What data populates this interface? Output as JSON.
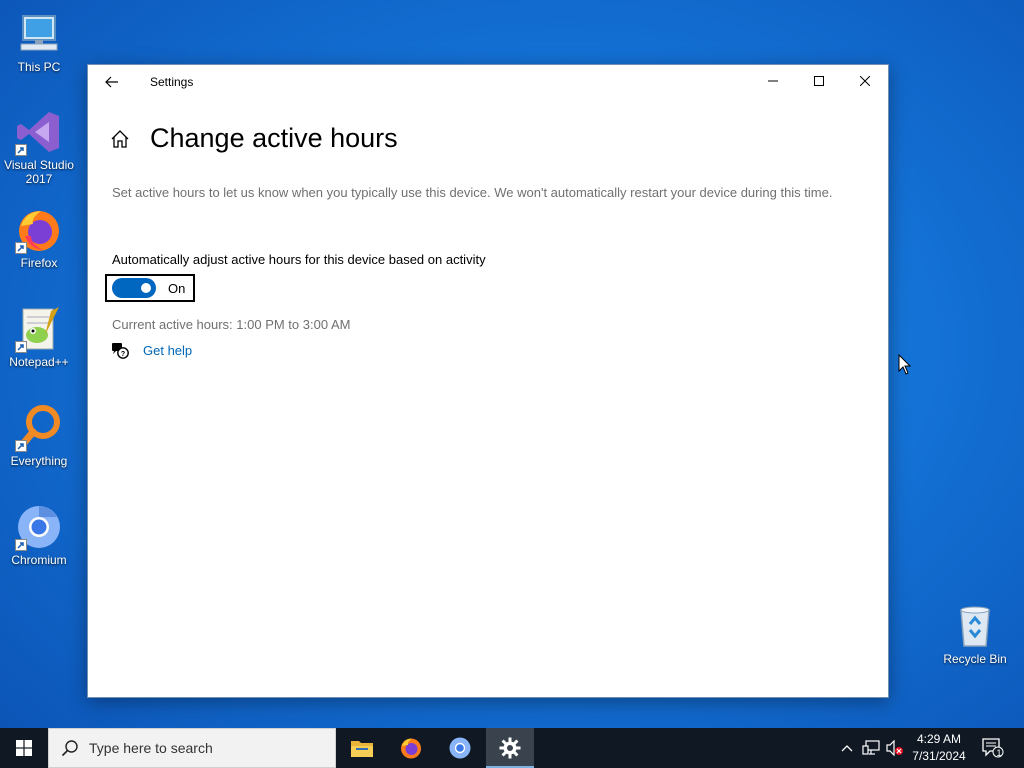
{
  "desktop": {
    "icons": [
      {
        "label": "This PC",
        "icon": "computer-icon"
      },
      {
        "label": "Visual Studio 2017",
        "icon": "visual-studio-icon"
      },
      {
        "label": "Firefox",
        "icon": "firefox-icon"
      },
      {
        "label": "Notepad++",
        "icon": "notepad-plus-plus-icon"
      },
      {
        "label": "Everything",
        "icon": "everything-search-icon"
      },
      {
        "label": "Chromium",
        "icon": "chromium-icon"
      },
      {
        "label": "Recycle Bin",
        "icon": "recycle-bin-icon"
      }
    ]
  },
  "window": {
    "title": "Settings",
    "controls": {
      "minimize": "minimize-icon",
      "maximize": "maximize-icon",
      "close": "close-icon"
    }
  },
  "page": {
    "title": "Change active hours",
    "description": "Set active hours to let us know when you typically use this device. We won't automatically restart your device during this time.",
    "toggle_label": "Automatically adjust active hours for this device based on activity",
    "toggle_state": "On",
    "toggle_on": true,
    "current_hours": "Current active hours: 1:00 PM to 3:00 AM",
    "help_link": "Get help"
  },
  "taskbar": {
    "search_placeholder": "Type here to search",
    "apps": [
      "File Explorer",
      "Firefox",
      "Chromium",
      "Settings"
    ],
    "active_app": "Settings",
    "time": "4:29 AM",
    "date": "7/31/2024",
    "notification_count": "1"
  },
  "colors": {
    "accent": "#0067c0",
    "link": "#0067b8",
    "taskbar": "#101923",
    "desktop": "#1472d6"
  }
}
